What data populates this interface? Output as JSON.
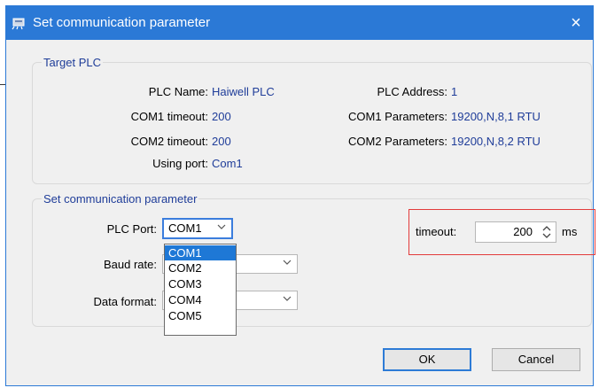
{
  "window": {
    "title": "Set communication parameter",
    "close_glyph": "×"
  },
  "target_plc": {
    "legend": "Target PLC",
    "plc_name_label": "PLC Name:",
    "plc_name_value": "Haiwell PLC",
    "plc_address_label": "PLC Address:",
    "plc_address_value": "1",
    "com1_timeout_label": "COM1 timeout:",
    "com1_timeout_value": "200",
    "com1_params_label": "COM1 Parameters:",
    "com1_params_value": "19200,N,8,1 RTU",
    "com2_timeout_label": "COM2 timeout:",
    "com2_timeout_value": "200",
    "com2_params_label": "COM2 Parameters:",
    "com2_params_value": "19200,N,8,2 RTU",
    "using_port_label": "Using port:",
    "using_port_value": "Com1"
  },
  "set_params": {
    "legend": "Set communication parameter",
    "plc_port_label": "PLC Port:",
    "plc_port_value": "COM1",
    "baud_rate_label": "Baud rate:",
    "data_format_label": "Data format:",
    "port_options": [
      "COM1",
      "COM2",
      "COM3",
      "COM4",
      "COM5"
    ],
    "timeout_label": "timeout:",
    "timeout_value": "200",
    "timeout_unit": "ms"
  },
  "buttons": {
    "ok": "OK",
    "cancel": "Cancel"
  },
  "colors": {
    "titlebar": "#2b79d6",
    "value_text": "#1f3d99",
    "selection": "#1e78d6",
    "highlight": "#e33b3b"
  }
}
